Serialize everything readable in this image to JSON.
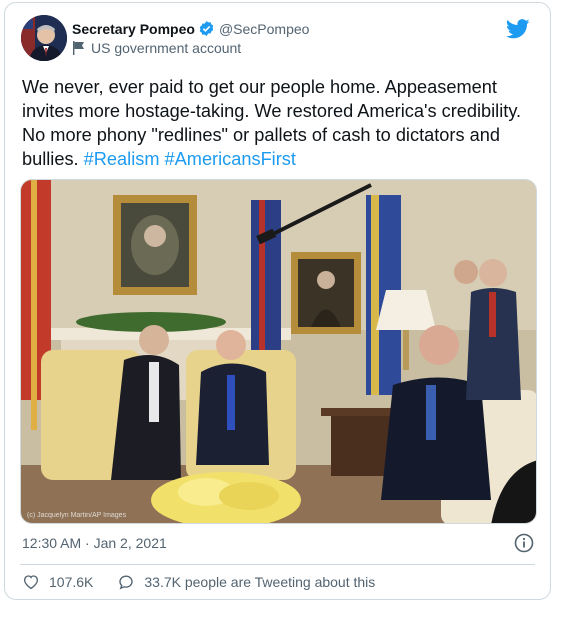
{
  "author": {
    "name": "Secretary Pompeo",
    "handle": "@SecPompeo",
    "account_label": "US government account"
  },
  "tweet": {
    "text_parts": [
      {
        "text": "We never, ever paid to get our people home. Appeasement invites more hostage-taking. We restored America's credibility. No more phony \"redlines\" or pallets of cash to dictators and bullies. ",
        "hashtag": false
      },
      {
        "text": "#Realism",
        "hashtag": true
      },
      {
        "text": " ",
        "hashtag": false
      },
      {
        "text": "#AmericansFirst",
        "hashtag": true
      }
    ],
    "photo_credit": "(c) Jacquelyn Martin/AP Images",
    "timestamp": "12:30 AM · Jan 2, 2021"
  },
  "stats": {
    "likes": "107.6K",
    "conversation": "33.7K people are Tweeting about this"
  },
  "colors": {
    "brand_blue": "#1d9bf0",
    "text_secondary": "#536471",
    "border": "#cfd9de"
  },
  "icons": {
    "verified": "verified-badge-icon",
    "government": "flag-icon",
    "brand": "twitter-bird-icon",
    "info": "info-icon",
    "like": "heart-icon",
    "reply": "speech-bubble-icon"
  }
}
